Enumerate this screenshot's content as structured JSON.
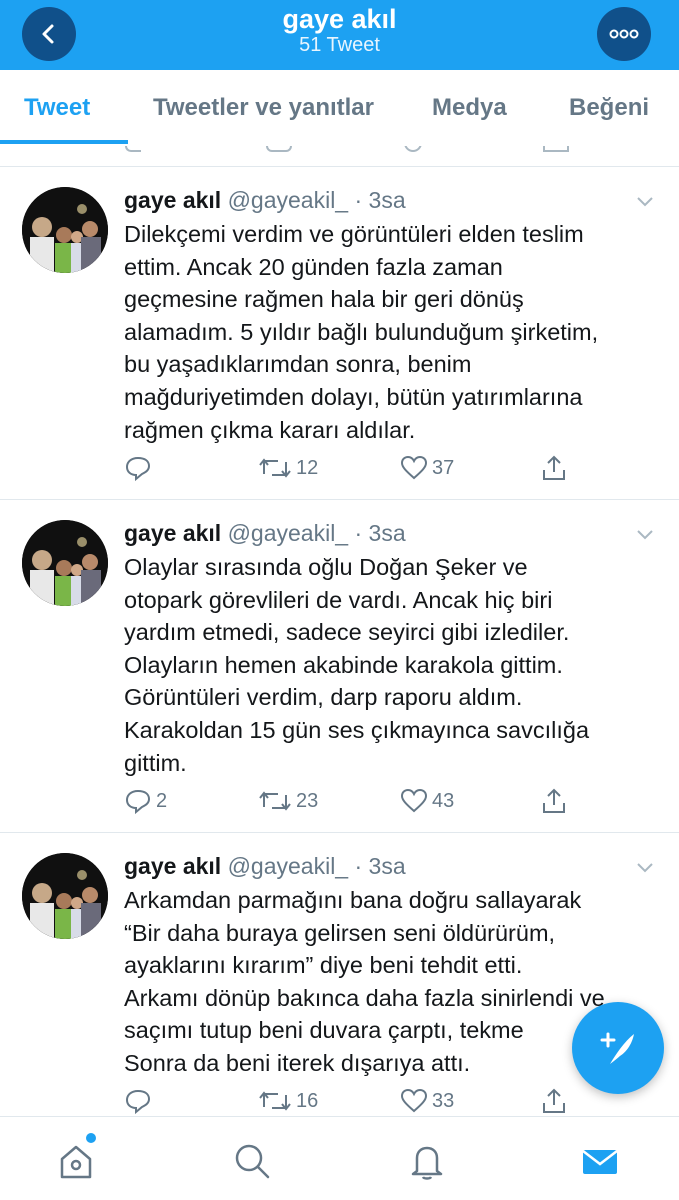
{
  "header": {
    "title": "gaye akıl",
    "subtitle": "51 Tweet",
    "back_icon": "chevron-left-icon",
    "more_icon": "more-dots-icon",
    "color": "#1da1f2"
  },
  "tabs": [
    {
      "label": "Tweet",
      "active": true
    },
    {
      "label": "Tweetler ve yanıtlar",
      "active": false
    },
    {
      "label": "Medya",
      "active": false
    },
    {
      "label": "Beğeni",
      "active": false
    }
  ],
  "tweets": [
    {
      "name": "gaye akıl",
      "handle": "@gayeakil_ · 3sa",
      "lines": [
        "Dilekçemi verdim ve görüntüleri elden teslim",
        "ettim. Ancak 20 günden  fazla zaman",
        "geçmesine rağmen hala bir geri dönüş",
        "alamadım. 5 yıldır bağlı bulunduğum şirketim,",
        "bu yaşadıklarımdan sonra, benim",
        "mağduriyetimden dolayı, bütün yatırımlarına",
        "rağmen çıkma kararı aldılar."
      ],
      "replies": "",
      "retweets": "12",
      "likes": "37"
    },
    {
      "name": "gaye akıl",
      "handle": "@gayeakil_ · 3sa",
      "lines": [
        "Olaylar sırasında oğlu Doğan Şeker ve",
        "otopark görevlileri de vardı. Ancak hiç biri",
        "yardım etmedi, sadece seyirci gibi izlediler.",
        "Olayların hemen akabinde karakola gittim.",
        "Görüntüleri verdim, darp  raporu aldım.",
        "Karakoldan 15 gün ses çıkmayınca savcılığa",
        "gittim."
      ],
      "replies": "2",
      "retweets": "23",
      "likes": "43"
    },
    {
      "name": "gaye akıl",
      "handle": "@gayeakil_ · 3sa",
      "lines": [
        "Arkamdan parmağını bana doğru sallayarak",
        "“Bir  daha  buraya gelirsen seni öldürürüm,",
        "ayaklarını kırarım” diye beni  tehdit  etti.",
        "Arkamı dönüp bakınca daha fazla sinirlendi ve",
        "saçımı tutup  beni  duvara çarptı, tekme",
        "Sonra da beni iterek  dışarıya attı."
      ],
      "replies": "",
      "retweets": "16",
      "likes": "33"
    }
  ],
  "nav": {
    "items": [
      "home-icon",
      "search-icon",
      "notifications-icon",
      "messages-icon"
    ],
    "active": "messages-icon"
  },
  "fab": {
    "icon": "compose-tweet-icon"
  },
  "colors": {
    "accent": "#1da1f2",
    "secondary_text": "#657786",
    "divider": "#e1e8ed"
  }
}
